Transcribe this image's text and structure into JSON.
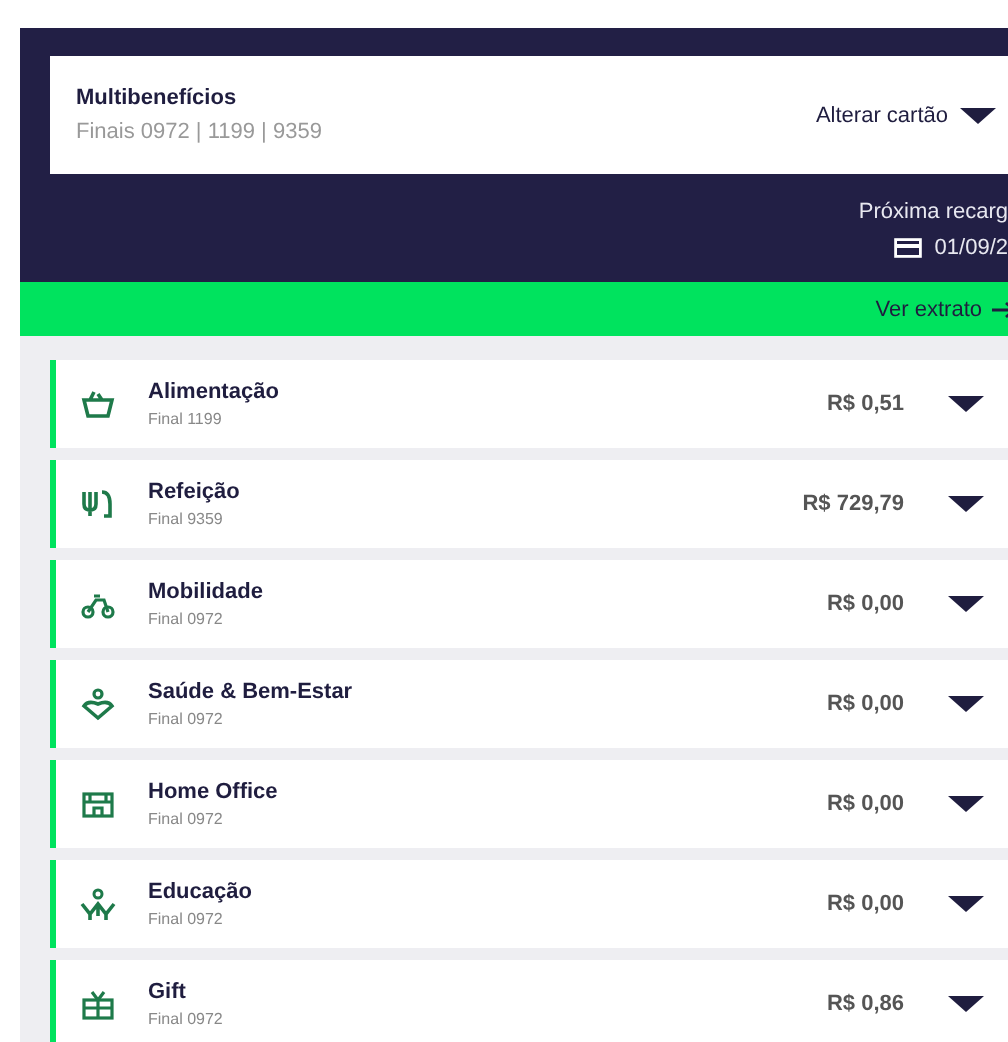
{
  "card_selector": {
    "title": "Multibenefícios",
    "subtitle": "Finais 0972 | 1199 | 9359",
    "action": "Alterar cartão"
  },
  "next_recharge": {
    "label": "Próxima recarg",
    "date": "01/09/2"
  },
  "statement_link": {
    "label": "Ver extrato"
  },
  "benefits": [
    {
      "kind": "food",
      "name": "Alimentação",
      "card": "Final 1199",
      "balance": "R$ 0,51"
    },
    {
      "kind": "meal",
      "name": "Refeição",
      "card": "Final 9359",
      "balance": "R$ 729,79"
    },
    {
      "kind": "mobility",
      "name": "Mobilidade",
      "card": "Final 0972",
      "balance": "R$ 0,00"
    },
    {
      "kind": "health",
      "name": "Saúde & Bem-Estar",
      "card": "Final 0972",
      "balance": "R$ 0,00"
    },
    {
      "kind": "office",
      "name": "Home Office",
      "card": "Final 0972",
      "balance": "R$ 0,00"
    },
    {
      "kind": "education",
      "name": "Educação",
      "card": "Final 0972",
      "balance": "R$ 0,00"
    },
    {
      "kind": "gift",
      "name": "Gift",
      "card": "Final 0972",
      "balance": "R$ 0,86"
    }
  ]
}
